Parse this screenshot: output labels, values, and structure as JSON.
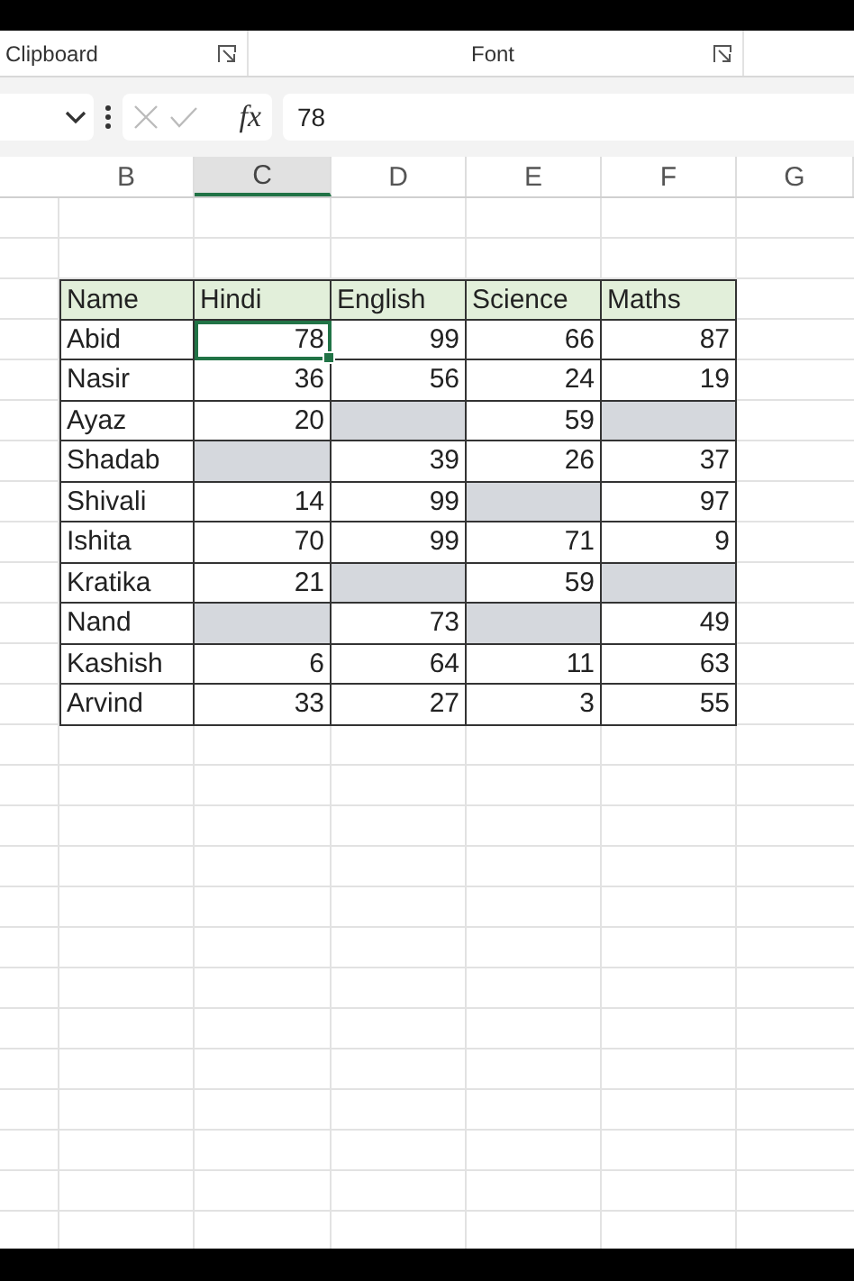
{
  "ribbon": {
    "groups": [
      "Clipboard",
      "Font"
    ]
  },
  "formula_bar": {
    "function_label": "fx",
    "value": "78"
  },
  "column_headers": [
    {
      "label": "B",
      "selected": false
    },
    {
      "label": "C",
      "selected": true
    },
    {
      "label": "D",
      "selected": false
    },
    {
      "label": "E",
      "selected": false
    },
    {
      "label": "F",
      "selected": false
    },
    {
      "label": "G",
      "selected": false
    }
  ],
  "table": {
    "columns": [
      "Name",
      "Hindi",
      "English",
      "Science",
      "Maths"
    ],
    "rows": [
      {
        "name": "Abid",
        "cells": [
          {
            "value": "78",
            "selected": false,
            "active": true
          },
          {
            "value": "99",
            "selected": false,
            "active": false
          },
          {
            "value": "66",
            "selected": false,
            "active": false
          },
          {
            "value": "87",
            "selected": false,
            "active": false
          }
        ]
      },
      {
        "name": "Nasir",
        "cells": [
          {
            "value": "36",
            "selected": false,
            "active": false
          },
          {
            "value": "56",
            "selected": false,
            "active": false
          },
          {
            "value": "24",
            "selected": false,
            "active": false
          },
          {
            "value": "19",
            "selected": false,
            "active": false
          }
        ]
      },
      {
        "name": "Ayaz",
        "cells": [
          {
            "value": "20",
            "selected": false,
            "active": false
          },
          {
            "selected": true,
            "active": false
          },
          {
            "value": "59",
            "selected": false,
            "active": false
          },
          {
            "selected": true,
            "active": false
          }
        ]
      },
      {
        "name": "Shadab",
        "cells": [
          {
            "selected": true,
            "active": false
          },
          {
            "value": "39",
            "selected": false,
            "active": false
          },
          {
            "value": "26",
            "selected": false,
            "active": false
          },
          {
            "value": "37",
            "selected": false,
            "active": false
          }
        ]
      },
      {
        "name": "Shivali",
        "cells": [
          {
            "value": "14",
            "selected": false,
            "active": false
          },
          {
            "value": "99",
            "selected": false,
            "active": false
          },
          {
            "selected": true,
            "active": false
          },
          {
            "value": "97",
            "selected": false,
            "active": false
          }
        ]
      },
      {
        "name": "Ishita",
        "cells": [
          {
            "value": "70",
            "selected": false,
            "active": false
          },
          {
            "value": "99",
            "selected": false,
            "active": false
          },
          {
            "value": "71",
            "selected": false,
            "active": false
          },
          {
            "value": "9",
            "selected": false,
            "active": false
          }
        ]
      },
      {
        "name": "Kratika",
        "cells": [
          {
            "value": "21",
            "selected": false,
            "active": false
          },
          {
            "selected": true,
            "active": false
          },
          {
            "value": "59",
            "selected": false,
            "active": false
          },
          {
            "selected": true,
            "active": false
          }
        ]
      },
      {
        "name": "Nand",
        "cells": [
          {
            "selected": true,
            "active": false
          },
          {
            "value": "73",
            "selected": false,
            "active": false
          },
          {
            "selected": true,
            "active": false
          },
          {
            "value": "49",
            "selected": false,
            "active": false
          }
        ]
      },
      {
        "name": "Kashish",
        "cells": [
          {
            "value": "6",
            "selected": false,
            "active": false
          },
          {
            "value": "64",
            "selected": false,
            "active": false
          },
          {
            "value": "11",
            "selected": false,
            "active": false
          },
          {
            "value": "63",
            "selected": false,
            "active": false
          }
        ]
      },
      {
        "name": "Arvind",
        "cells": [
          {
            "value": "33",
            "selected": false,
            "active": false
          },
          {
            "value": "27",
            "selected": false,
            "active": false
          },
          {
            "value": "3",
            "selected": false,
            "active": false
          },
          {
            "value": "55",
            "selected": false,
            "active": false
          }
        ]
      }
    ]
  }
}
